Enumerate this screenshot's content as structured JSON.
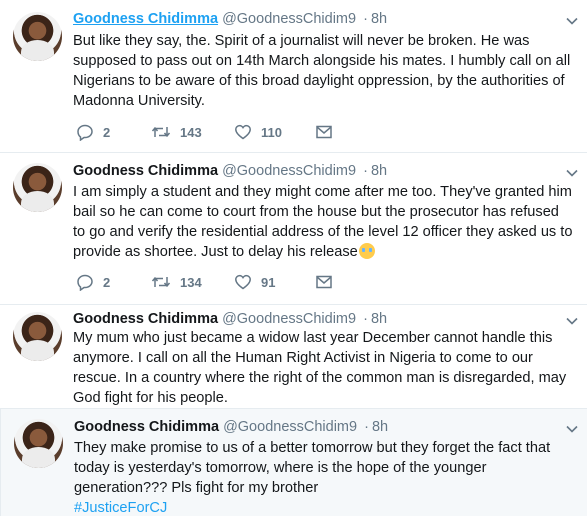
{
  "colors": {
    "link_blue": "#1da1f2",
    "muted": "#657786",
    "border": "#e6ecf0",
    "highlight_bg": "#f5f8fa"
  },
  "tweets": [
    {
      "name": "Goodness Chidimma",
      "handle": "@GoodnessChidim9",
      "separator": "·",
      "time": "8h",
      "text": "But like they say, the. Spirit of a journalist will never be broken. He was supposed to pass out on 14th March alongside his mates. I humbly call on all Nigerians to be aware of this broad daylight oppression, by the authorities of Madonna University.",
      "replies": "2",
      "retweets": "143",
      "likes": "110"
    },
    {
      "name": "Goodness Chidimma",
      "handle": "@GoodnessChidim9",
      "separator": "·",
      "time": "8h",
      "text": "I am simply a student and they might come after me too. They've granted him bail so he can come to court from the house but the prosecutor has refused to go and verify the residential address of the level 12 officer they asked us to provide as shortee. Just to delay his release",
      "emoji": "crying-face-emoji",
      "replies": "2",
      "retweets": "134",
      "likes": "91"
    },
    {
      "name": "Goodness Chidimma",
      "handle": "@GoodnessChidim9",
      "separator": "·",
      "time": "8h",
      "text": "My mum who just became a widow last year December cannot handle this anymore. I call on all the Human Right Activist in Nigeria to come to our rescue. In a country where the right of the common man is disregarded, may God fight for his people."
    },
    {
      "name": "Goodness Chidimma",
      "handle": "@GoodnessChidim9",
      "separator": "·",
      "time": "8h",
      "text": "They make promise to us of a better tomorrow but they forget the fact that today is yesterday's tomorrow, where is the hope of the younger generation??? Pls fight for my brother",
      "hashtag": "#JusticeForCJ"
    }
  ]
}
